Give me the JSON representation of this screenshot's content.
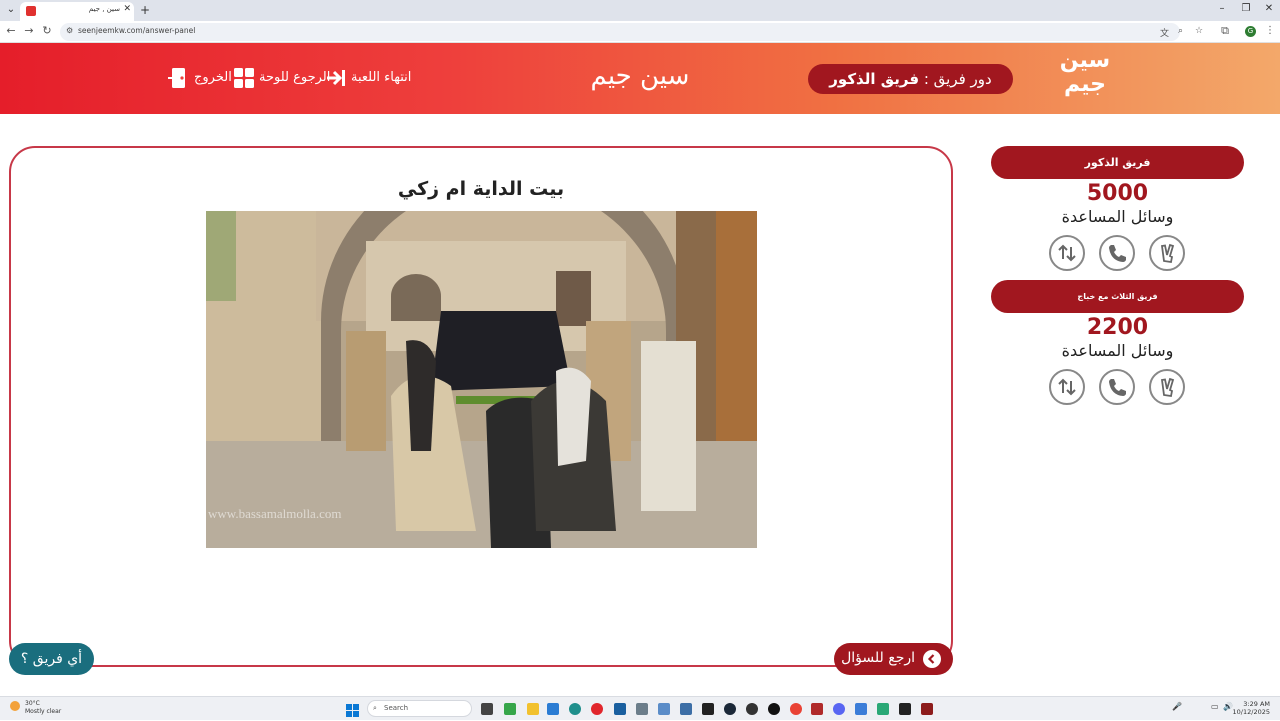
{
  "browser": {
    "tab_title": "سين , جيم",
    "url": "seenjeemkw.com/answer-panel",
    "new_tab": "+",
    "profile_initial": "G"
  },
  "header": {
    "logo_text": "سين جيم",
    "turn_label": "دور فريق :",
    "turn_team": "فريق الذكور",
    "site_title": "سين جيم",
    "nav": {
      "end_game": "انتهاء اللعبة",
      "back_to_board": "الرجوع للوحة",
      "exit": "الخروج"
    }
  },
  "question": {
    "title": "بيت الداية ام زكي",
    "watermark": "www.bassamalmolla.com"
  },
  "buttons": {
    "back_to_question": "ارجع للسؤال",
    "which_team": "أي فريق ؟"
  },
  "teams": [
    {
      "name": "فريق الذكور",
      "score": "5000",
      "aids_label": "وسائل المساعدة"
    },
    {
      "name": "فريق الثلاث مع خباج",
      "score": "2200",
      "aids_label": "وسائل المساعدة"
    }
  ],
  "taskbar": {
    "weather_temp": "30°C",
    "weather_desc": "Mostly clear",
    "search_placeholder": "Search",
    "time": "3:29 AM",
    "date": "10/12/2025"
  },
  "colors": {
    "brand_dark_red": "#a1171f",
    "header_gradient_start": "#e51e2a",
    "header_gradient_end": "#f3a86a",
    "teal": "#1a6e7e"
  }
}
